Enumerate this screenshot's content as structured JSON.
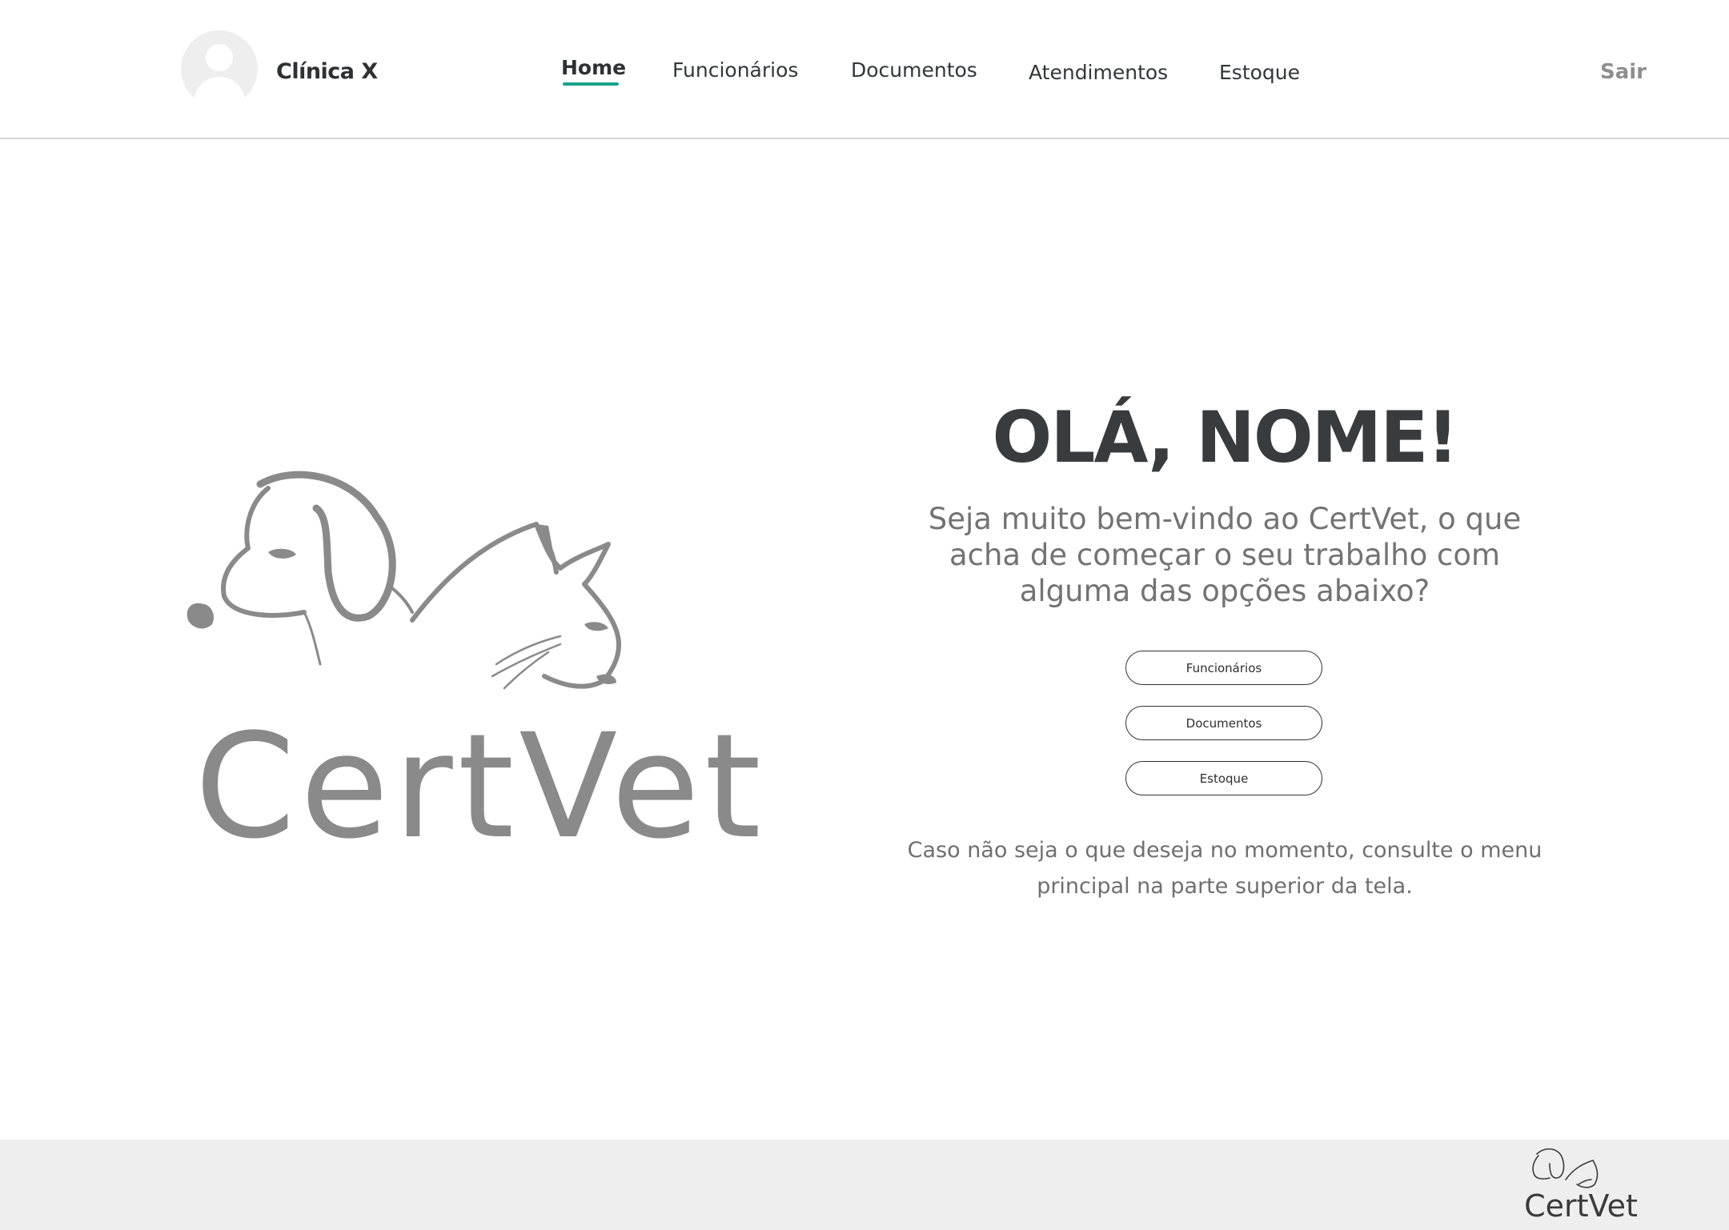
{
  "header": {
    "clinic_name": "Clínica X",
    "nav": [
      "Home",
      "Funcionários",
      "Documentos",
      "Atendimentos",
      "Estoque"
    ],
    "active_nav": "Home",
    "logout_label": "Sair"
  },
  "brand": {
    "logo_text": "CertVet",
    "accent_color": "#1aa38a",
    "logo_color": "#8a8a8a"
  },
  "main": {
    "greeting": "OLÁ, NOME!",
    "welcome": "Seja muito bem-vindo ao CertVet, o que acha de começar o seu trabalho com alguma das opções abaixo?",
    "buttons": [
      "Funcionários",
      "Documentos",
      "Estoque"
    ],
    "hint": "Caso não seja o que deseja no momento, consulte o menu principal na parte superior da tela."
  },
  "footer": {
    "logo_text": "CertVet"
  }
}
